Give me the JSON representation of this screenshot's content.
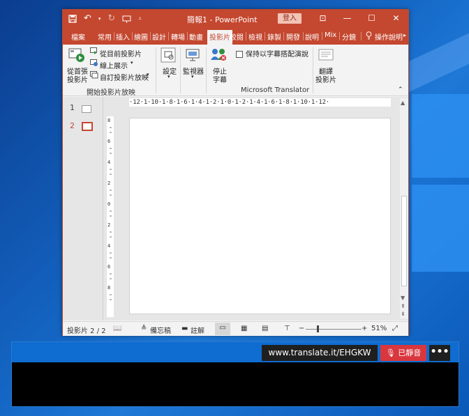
{
  "powerpoint": {
    "title": "簡報1 - PowerPoint",
    "signin_label": "登入",
    "qat": {
      "save_icon": "save-icon",
      "undo_icon": "undo-icon",
      "redo_icon": "redo-icon",
      "present_icon": "present-from-start-icon",
      "customize_icon": "customize-qat-icon"
    },
    "window_controls": [
      "ribbon-display-options-icon",
      "minimize-icon",
      "maximize-icon",
      "close-icon"
    ],
    "tabs": [
      {
        "label": "檔案"
      },
      {
        "label": "常用"
      },
      {
        "label": "插入"
      },
      {
        "label": "繪圖"
      },
      {
        "label": "設計"
      },
      {
        "label": "轉場"
      },
      {
        "label": "動畫"
      },
      {
        "label": "投影片"
      },
      {
        "label": "校閱"
      },
      {
        "label": "檢視"
      },
      {
        "label": "錄製"
      },
      {
        "label": "開發"
      },
      {
        "label": "說明"
      },
      {
        "label": "Mix"
      },
      {
        "label": "分鏡"
      },
      {
        "label": "操作說明"
      }
    ],
    "active_tab": "投影片",
    "ribbon": {
      "from_beginning": "從首張\n投影片",
      "from_beginning_l1": "從首張",
      "from_beginning_l2": "投影片",
      "from_current": "從目前投影片",
      "online": "線上展示",
      "custom": "自訂投影片放映",
      "group_start": "開始投影片放映",
      "setup": "設定",
      "monitor": "監視器",
      "stop_l1": "停止",
      "stop_l2": "字幕",
      "keep_subtitles": "保持以字幕搭配演說",
      "translate_l1": "翻譯",
      "translate_l2": "投影片",
      "group_translator": "Microsoft Translator"
    },
    "slides": [
      {
        "number": "1"
      },
      {
        "number": "2"
      }
    ],
    "hruler_text": "·12·1·10·1·8·1·6·1·4·1·2·1·0·1·2·1·4·1·6·1·8·1·10·1·12·",
    "status": {
      "slide_info": "投影片 2 / 2",
      "notes": "備忘稿",
      "comments": "註解",
      "zoom": "51%"
    }
  },
  "translator_bar": {
    "url": "www.translate.it/EHGKW",
    "mute_label": "已靜音",
    "more_label": "•••"
  }
}
